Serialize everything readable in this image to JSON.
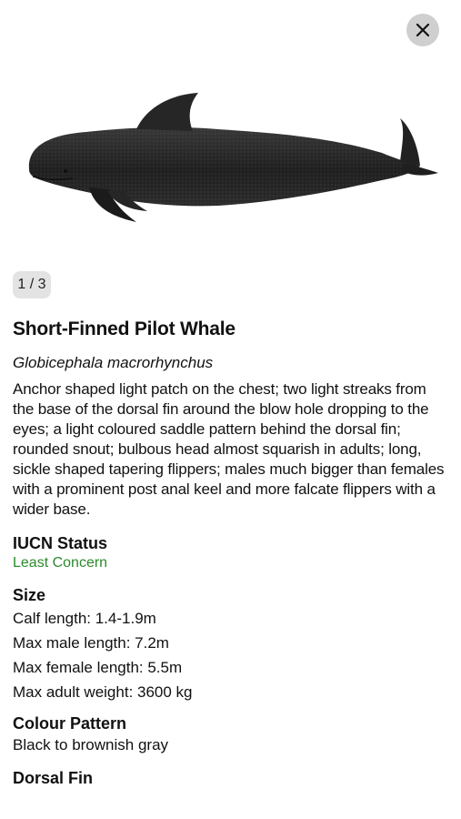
{
  "header": {
    "close_icon": "close-icon"
  },
  "hero": {
    "image_subject": "short-finned-pilot-whale-illustration"
  },
  "pager": {
    "label": "1 / 3"
  },
  "species": {
    "common_name": "Short-Finned Pilot Whale",
    "scientific_name": "Globicephala macrorhynchus",
    "description": "Anchor shaped light patch on the chest; two light streaks from the base of the dorsal fin around the blow hole dropping to the eyes; a light coloured saddle pattern behind the dorsal fin; rounded snout; bulbous head almost squarish in adults; long, sickle shaped tapering flippers; males much bigger than females with a prominent post anal keel and more falcate flippers with a wider base."
  },
  "iucn": {
    "title": "IUCN Status",
    "value": "Least Concern",
    "color": "#2c8a2c"
  },
  "size": {
    "title": "Size",
    "lines": [
      "Calf length: 1.4-1.9m",
      "Max male length: 7.2m",
      "Max female length: 5.5m",
      "Max adult weight: 3600 kg"
    ]
  },
  "colour_pattern": {
    "title": "Colour Pattern",
    "value": "Black to brownish gray"
  },
  "dorsal_fin": {
    "title": "Dorsal Fin"
  }
}
